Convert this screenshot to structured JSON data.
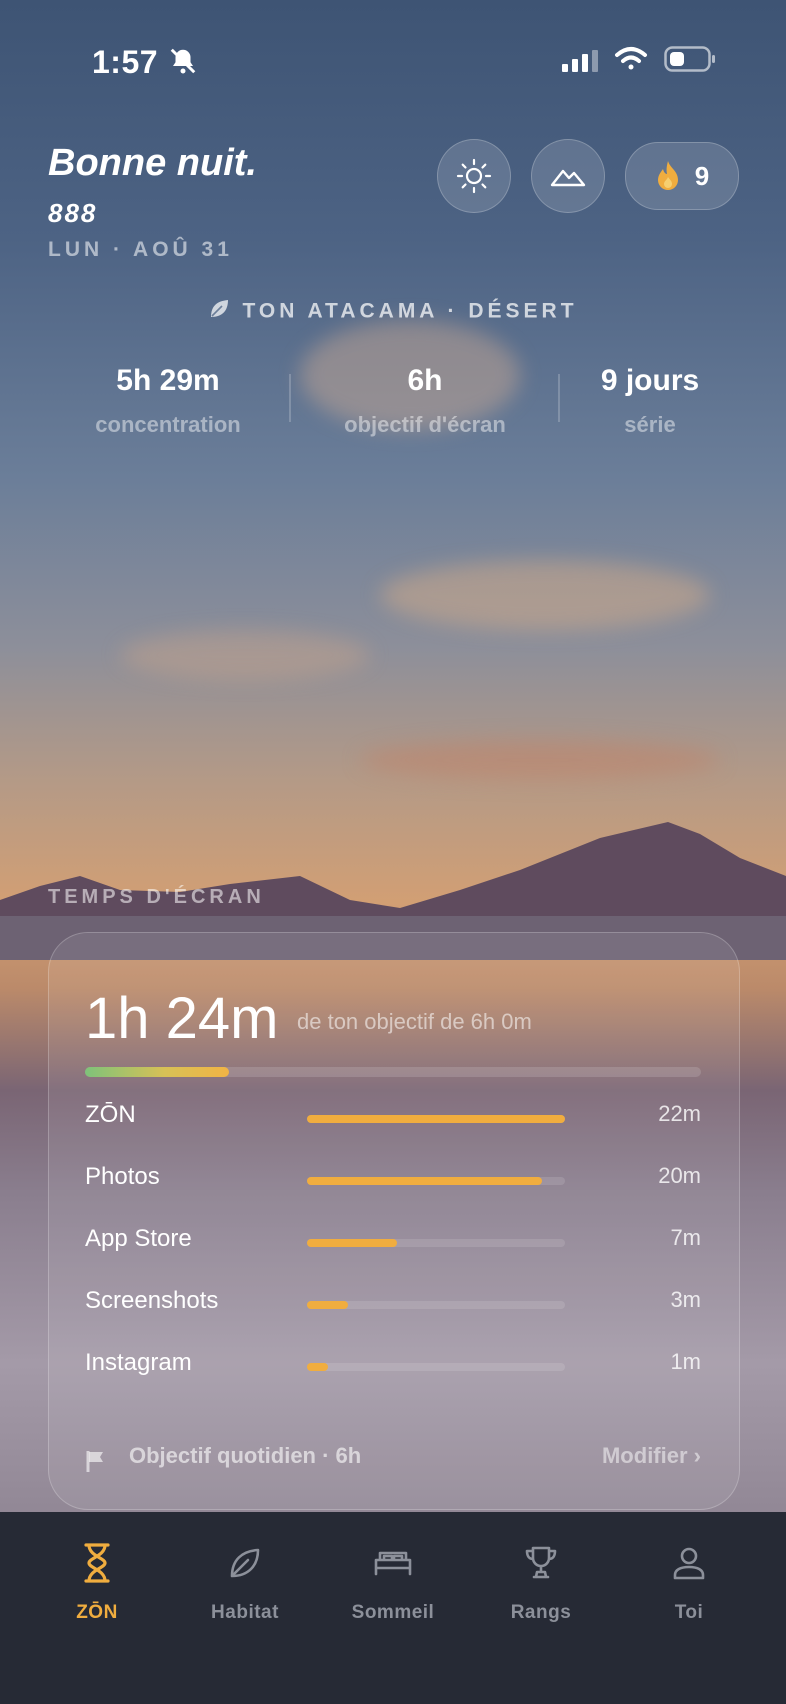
{
  "status_bar": {
    "time": "1:57"
  },
  "header": {
    "greeting": "Bonne nuit.",
    "subtitle": "888",
    "date": "LUN · AOÛ 31",
    "streak_count": "9"
  },
  "habitat": {
    "location": "TON ATACAMA · DÉSERT",
    "stats": [
      {
        "value": "5h 29m",
        "label": "concentration"
      },
      {
        "value": "6h",
        "label": "objectif d'écran"
      },
      {
        "value": "9 jours",
        "label": "série"
      }
    ]
  },
  "screen_time": {
    "section_title": "TEMPS D'ÉCRAN",
    "total": "1h 24m",
    "goal_text": "de ton objectif de 6h 0m",
    "total_fraction": 0.233,
    "apps": [
      {
        "name": "ZŌN",
        "duration": "22m",
        "fraction": 1.0
      },
      {
        "name": "Photos",
        "duration": "20m",
        "fraction": 0.91
      },
      {
        "name": "App Store",
        "duration": "7m",
        "fraction": 0.35
      },
      {
        "name": "Screenshots",
        "duration": "3m",
        "fraction": 0.16
      },
      {
        "name": "Instagram",
        "duration": "1m",
        "fraction": 0.08
      }
    ],
    "daily_goal_label": "Objectif quotidien · 6h",
    "edit_label": "Modifier"
  },
  "tabbar": {
    "tabs": [
      {
        "label": "ZŌN",
        "icon": "hourglass-icon",
        "active": true
      },
      {
        "label": "Habitat",
        "icon": "leaf-icon",
        "active": false
      },
      {
        "label": "Sommeil",
        "icon": "bed-icon",
        "active": false
      },
      {
        "label": "Rangs",
        "icon": "trophy-icon",
        "active": false
      },
      {
        "label": "Toi",
        "icon": "person-icon",
        "active": false
      }
    ]
  },
  "colors": {
    "accent": "#f0ad3f",
    "tabbar_bg": "#262a35",
    "flame": "#f0ad3f"
  }
}
